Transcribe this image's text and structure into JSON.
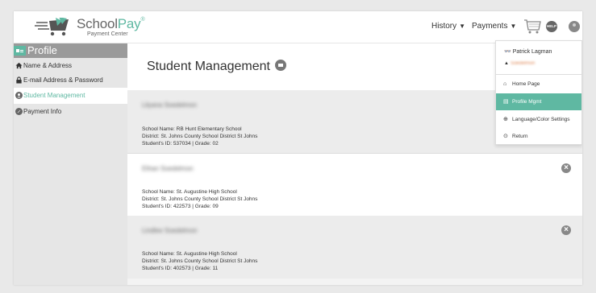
{
  "brand": {
    "name_part1": "School",
    "name_part2": "Pay",
    "trademark": "®",
    "subtitle": "Payment Center"
  },
  "topnav": {
    "history": "History",
    "payments": "Payments",
    "help_label": "HELP"
  },
  "sidebar": {
    "title": "Profile",
    "items": [
      {
        "label": "Name & Address",
        "icon": "home-icon"
      },
      {
        "label": "E-mail Address & Password",
        "icon": "lock-icon"
      },
      {
        "label": "Student Management",
        "icon": "student-icon"
      },
      {
        "label": "Payment Info",
        "icon": "payment-icon"
      }
    ]
  },
  "main": {
    "title": "Student Management",
    "students": [
      {
        "name": "Lilyana Soedelmon",
        "school": "School Name: RB Hunt Elementary School",
        "district": "District: St. Johns County School District St Johns",
        "id_grade": "Student's ID: 537034 | Grade: 02"
      },
      {
        "name": "Ethan Soedelmon",
        "school": "School Name: St. Augustine High School",
        "district": "District: St. Johns County School District St Johns",
        "id_grade": "Student's ID: 422573 | Grade: 09"
      },
      {
        "name": "Lindlee Soedelmon",
        "school": "School Name: St. Augustine High School",
        "district": "District: St. Johns County School District St Johns",
        "id_grade": "Student's ID: 402573 | Grade: 11"
      }
    ]
  },
  "dropdown": {
    "username": "Patrick Lagman",
    "role": "Soedelmon",
    "items": [
      {
        "label": "Home Page",
        "icon": "home-icon"
      },
      {
        "label": "Profile Mgmt",
        "icon": "idcard-icon"
      },
      {
        "label": "Language/Color Settings",
        "icon": "globe-icon"
      },
      {
        "label": "Return",
        "icon": "return-icon"
      }
    ]
  },
  "colors": {
    "accent": "#5fb8a2",
    "sidebar_bg": "#e6e6e6",
    "sidebar_header": "#9a9a9a",
    "role_text": "#e08a5a"
  }
}
